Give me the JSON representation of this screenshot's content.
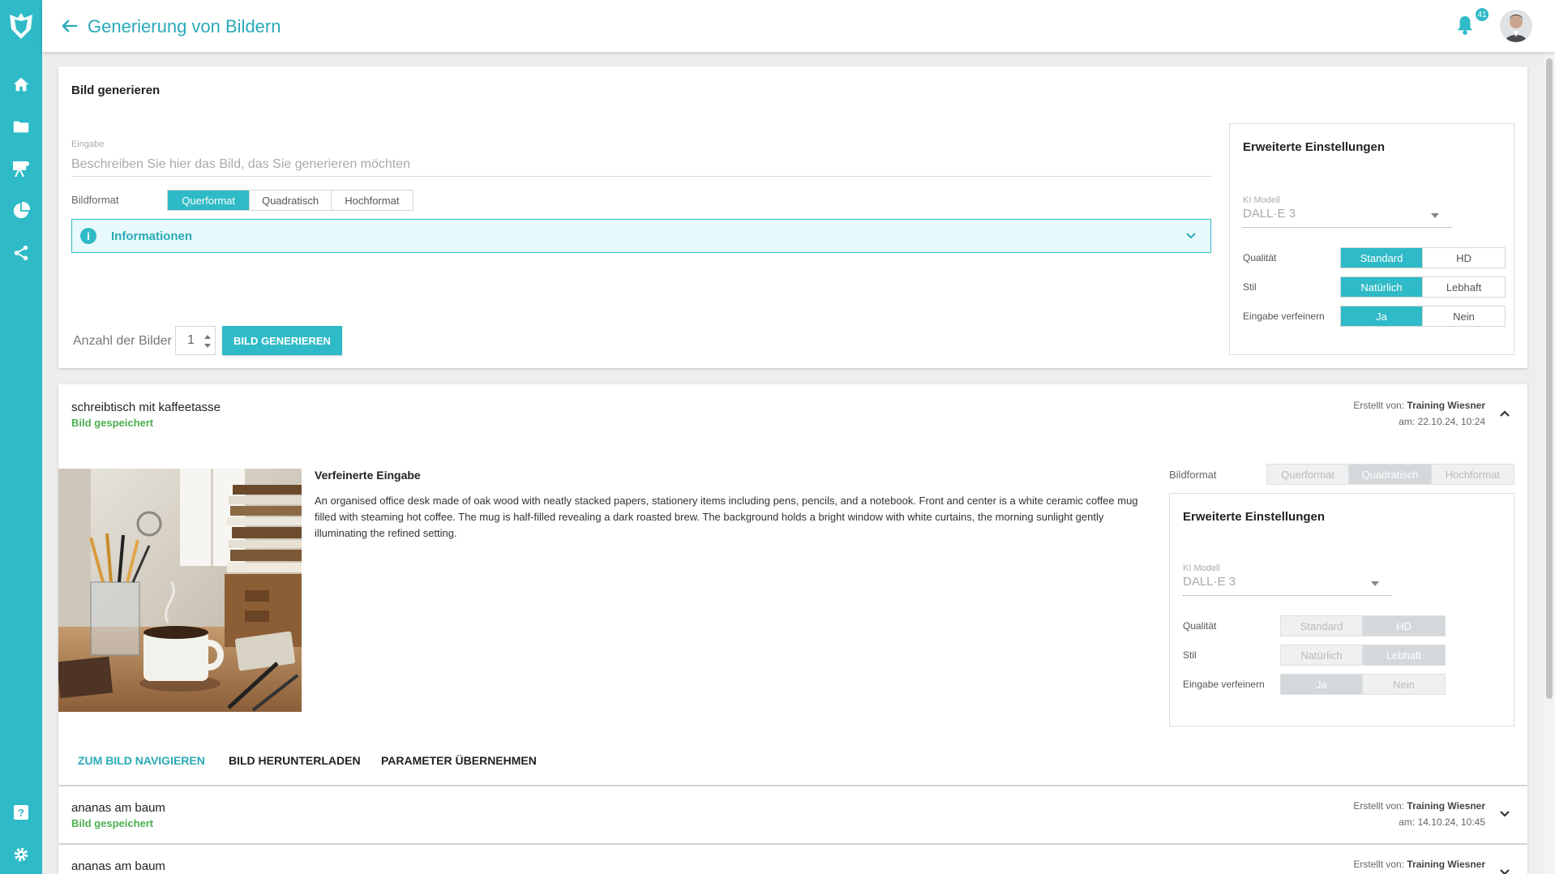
{
  "colors": {
    "accent": "#2fbac7",
    "saved": "#4caf50"
  },
  "header": {
    "title": "Generierung von Bildern",
    "notification_count": "41",
    "icons": [
      "back-arrow-icon",
      "bell-icon",
      "avatar"
    ]
  },
  "sidebar": {
    "items": [
      {
        "name": "home",
        "icon": "home-icon"
      },
      {
        "name": "files",
        "icon": "folder-icon"
      },
      {
        "name": "training",
        "icon": "presentation-icon"
      },
      {
        "name": "analytics",
        "icon": "pie-chart-icon"
      },
      {
        "name": "share",
        "icon": "share-icon"
      },
      {
        "name": "help",
        "icon": "help-icon"
      },
      {
        "name": "settings",
        "icon": "gear-icon"
      }
    ]
  },
  "generate": {
    "card_title": "Bild generieren",
    "input_label": "Eingabe",
    "input_placeholder": "Beschreiben Sie hier das Bild, das Sie generieren möchten",
    "format_label": "Bildformat",
    "formats": [
      "Querformat",
      "Quadratisch",
      "Hochformat"
    ],
    "format_selected": "Querformat",
    "info_label": "Informationen",
    "count_label": "Anzahl der Bilder",
    "count_value": "1",
    "generate_button": "BILD GENERIEREN",
    "advanced": {
      "title": "Erweiterte Einstellungen",
      "model_label": "KI Modell",
      "model_value": "DALL·E 3",
      "quality_label": "Qualität",
      "quality_options": [
        "Standard",
        "HD"
      ],
      "quality_selected": "Standard",
      "style_label": "Stil",
      "style_options": [
        "Natürlich",
        "Lebhaft"
      ],
      "style_selected": "Natürlich",
      "refine_label": "Eingabe verfeinern",
      "refine_options": [
        "Ja",
        "Nein"
      ],
      "refine_selected": "Ja"
    }
  },
  "results": [
    {
      "title": "schreibtisch mit kaffeetasse",
      "status": "Bild gespeichert",
      "created_by_label": "Erstellt von:",
      "created_by": "Training Wiesner",
      "date": "am: 22.10.24, 10:24",
      "expanded": true,
      "refined_title": "Verfeinerte Eingabe",
      "refined_text": "An organised office desk made of oak wood with neatly stacked papers, stationery items including pens, pencils, and a notebook. Front and center is a white ceramic coffee mug filled with steaming hot coffee. The mug is half-filled revealing a dark roasted brew. The background holds a bright window with white curtains, the morning sunlight gently illuminating the refined setting.",
      "format_label": "Bildformat",
      "formats": [
        "Querformat",
        "Quadratisch",
        "Hochformat"
      ],
      "format_selected": "Quadratisch",
      "advanced": {
        "title": "Erweiterte Einstellungen",
        "model_label": "KI Modell",
        "model_value": "DALL·E 3",
        "quality_label": "Qualität",
        "quality_options": [
          "Standard",
          "HD"
        ],
        "quality_selected": "HD",
        "style_label": "Stil",
        "style_options": [
          "Natürlich",
          "Lebhaft"
        ],
        "style_selected": "Lebhaft",
        "refine_label": "Eingabe verfeinern",
        "refine_options": [
          "Ja",
          "Nein"
        ],
        "refine_selected": "Ja"
      },
      "actions": [
        "ZUM BILD NAVIGIEREN",
        "BILD HERUNTERLADEN",
        "PARAMETER ÜBERNEHMEN"
      ]
    },
    {
      "title": "ananas am baum",
      "status": "Bild gespeichert",
      "created_by_label": "Erstellt von:",
      "created_by": "Training Wiesner",
      "date": "am: 14.10.24, 10:45",
      "expanded": false
    },
    {
      "title": "ananas am baum",
      "created_by_label": "Erstellt von:",
      "created_by": "Training Wiesner",
      "expanded": false
    }
  ]
}
